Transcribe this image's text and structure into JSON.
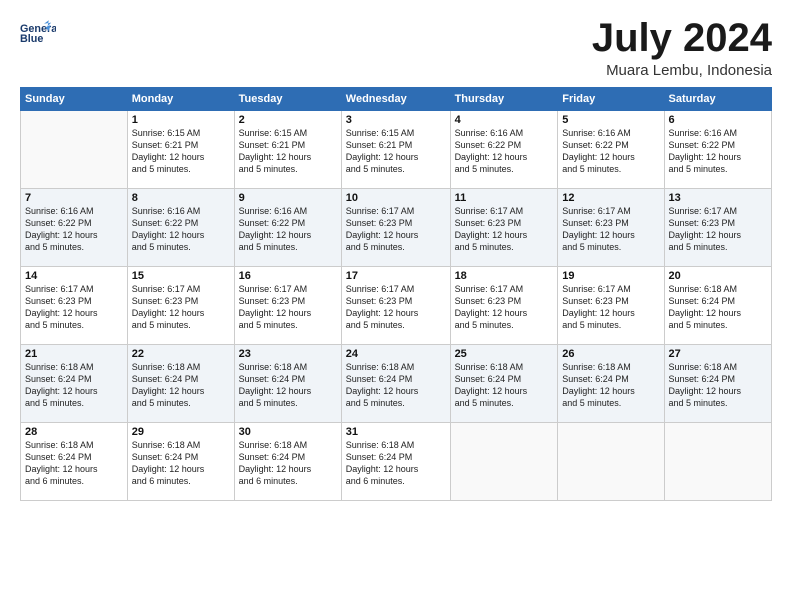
{
  "logo": {
    "line1": "General",
    "line2": "Blue"
  },
  "title": "July 2024",
  "location": "Muara Lembu, Indonesia",
  "days_header": [
    "Sunday",
    "Monday",
    "Tuesday",
    "Wednesday",
    "Thursday",
    "Friday",
    "Saturday"
  ],
  "weeks": [
    [
      {
        "day": "",
        "sunrise": "",
        "sunset": "",
        "daylight": ""
      },
      {
        "day": "1",
        "sunrise": "Sunrise: 6:15 AM",
        "sunset": "Sunset: 6:21 PM",
        "daylight": "Daylight: 12 hours and 5 minutes."
      },
      {
        "day": "2",
        "sunrise": "Sunrise: 6:15 AM",
        "sunset": "Sunset: 6:21 PM",
        "daylight": "Daylight: 12 hours and 5 minutes."
      },
      {
        "day": "3",
        "sunrise": "Sunrise: 6:15 AM",
        "sunset": "Sunset: 6:21 PM",
        "daylight": "Daylight: 12 hours and 5 minutes."
      },
      {
        "day": "4",
        "sunrise": "Sunrise: 6:16 AM",
        "sunset": "Sunset: 6:22 PM",
        "daylight": "Daylight: 12 hours and 5 minutes."
      },
      {
        "day": "5",
        "sunrise": "Sunrise: 6:16 AM",
        "sunset": "Sunset: 6:22 PM",
        "daylight": "Daylight: 12 hours and 5 minutes."
      },
      {
        "day": "6",
        "sunrise": "Sunrise: 6:16 AM",
        "sunset": "Sunset: 6:22 PM",
        "daylight": "Daylight: 12 hours and 5 minutes."
      }
    ],
    [
      {
        "day": "7",
        "sunrise": "Sunrise: 6:16 AM",
        "sunset": "Sunset: 6:22 PM",
        "daylight": "Daylight: 12 hours and 5 minutes."
      },
      {
        "day": "8",
        "sunrise": "Sunrise: 6:16 AM",
        "sunset": "Sunset: 6:22 PM",
        "daylight": "Daylight: 12 hours and 5 minutes."
      },
      {
        "day": "9",
        "sunrise": "Sunrise: 6:16 AM",
        "sunset": "Sunset: 6:22 PM",
        "daylight": "Daylight: 12 hours and 5 minutes."
      },
      {
        "day": "10",
        "sunrise": "Sunrise: 6:17 AM",
        "sunset": "Sunset: 6:23 PM",
        "daylight": "Daylight: 12 hours and 5 minutes."
      },
      {
        "day": "11",
        "sunrise": "Sunrise: 6:17 AM",
        "sunset": "Sunset: 6:23 PM",
        "daylight": "Daylight: 12 hours and 5 minutes."
      },
      {
        "day": "12",
        "sunrise": "Sunrise: 6:17 AM",
        "sunset": "Sunset: 6:23 PM",
        "daylight": "Daylight: 12 hours and 5 minutes."
      },
      {
        "day": "13",
        "sunrise": "Sunrise: 6:17 AM",
        "sunset": "Sunset: 6:23 PM",
        "daylight": "Daylight: 12 hours and 5 minutes."
      }
    ],
    [
      {
        "day": "14",
        "sunrise": "Sunrise: 6:17 AM",
        "sunset": "Sunset: 6:23 PM",
        "daylight": "Daylight: 12 hours and 5 minutes."
      },
      {
        "day": "15",
        "sunrise": "Sunrise: 6:17 AM",
        "sunset": "Sunset: 6:23 PM",
        "daylight": "Daylight: 12 hours and 5 minutes."
      },
      {
        "day": "16",
        "sunrise": "Sunrise: 6:17 AM",
        "sunset": "Sunset: 6:23 PM",
        "daylight": "Daylight: 12 hours and 5 minutes."
      },
      {
        "day": "17",
        "sunrise": "Sunrise: 6:17 AM",
        "sunset": "Sunset: 6:23 PM",
        "daylight": "Daylight: 12 hours and 5 minutes."
      },
      {
        "day": "18",
        "sunrise": "Sunrise: 6:17 AM",
        "sunset": "Sunset: 6:23 PM",
        "daylight": "Daylight: 12 hours and 5 minutes."
      },
      {
        "day": "19",
        "sunrise": "Sunrise: 6:17 AM",
        "sunset": "Sunset: 6:23 PM",
        "daylight": "Daylight: 12 hours and 5 minutes."
      },
      {
        "day": "20",
        "sunrise": "Sunrise: 6:18 AM",
        "sunset": "Sunset: 6:24 PM",
        "daylight": "Daylight: 12 hours and 5 minutes."
      }
    ],
    [
      {
        "day": "21",
        "sunrise": "Sunrise: 6:18 AM",
        "sunset": "Sunset: 6:24 PM",
        "daylight": "Daylight: 12 hours and 5 minutes."
      },
      {
        "day": "22",
        "sunrise": "Sunrise: 6:18 AM",
        "sunset": "Sunset: 6:24 PM",
        "daylight": "Daylight: 12 hours and 5 minutes."
      },
      {
        "day": "23",
        "sunrise": "Sunrise: 6:18 AM",
        "sunset": "Sunset: 6:24 PM",
        "daylight": "Daylight: 12 hours and 5 minutes."
      },
      {
        "day": "24",
        "sunrise": "Sunrise: 6:18 AM",
        "sunset": "Sunset: 6:24 PM",
        "daylight": "Daylight: 12 hours and 5 minutes."
      },
      {
        "day": "25",
        "sunrise": "Sunrise: 6:18 AM",
        "sunset": "Sunset: 6:24 PM",
        "daylight": "Daylight: 12 hours and 5 minutes."
      },
      {
        "day": "26",
        "sunrise": "Sunrise: 6:18 AM",
        "sunset": "Sunset: 6:24 PM",
        "daylight": "Daylight: 12 hours and 5 minutes."
      },
      {
        "day": "27",
        "sunrise": "Sunrise: 6:18 AM",
        "sunset": "Sunset: 6:24 PM",
        "daylight": "Daylight: 12 hours and 5 minutes."
      }
    ],
    [
      {
        "day": "28",
        "sunrise": "Sunrise: 6:18 AM",
        "sunset": "Sunset: 6:24 PM",
        "daylight": "Daylight: 12 hours and 6 minutes."
      },
      {
        "day": "29",
        "sunrise": "Sunrise: 6:18 AM",
        "sunset": "Sunset: 6:24 PM",
        "daylight": "Daylight: 12 hours and 6 minutes."
      },
      {
        "day": "30",
        "sunrise": "Sunrise: 6:18 AM",
        "sunset": "Sunset: 6:24 PM",
        "daylight": "Daylight: 12 hours and 6 minutes."
      },
      {
        "day": "31",
        "sunrise": "Sunrise: 6:18 AM",
        "sunset": "Sunset: 6:24 PM",
        "daylight": "Daylight: 12 hours and 6 minutes."
      },
      {
        "day": "",
        "sunrise": "",
        "sunset": "",
        "daylight": ""
      },
      {
        "day": "",
        "sunrise": "",
        "sunset": "",
        "daylight": ""
      },
      {
        "day": "",
        "sunrise": "",
        "sunset": "",
        "daylight": ""
      }
    ]
  ]
}
